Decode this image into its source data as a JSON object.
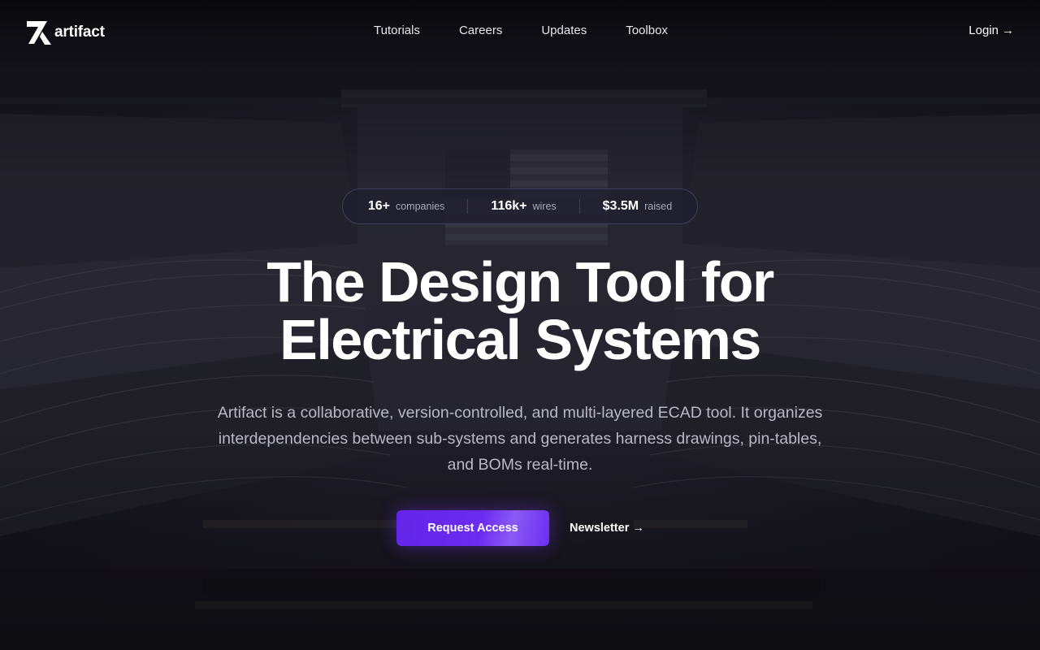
{
  "brand": {
    "name": "artifact",
    "logo_icon": "artifact-logo-icon"
  },
  "nav": {
    "links": [
      {
        "label": "Tutorials"
      },
      {
        "label": "Careers"
      },
      {
        "label": "Updates"
      },
      {
        "label": "Toolbox"
      }
    ],
    "login_label": "Login",
    "login_arrow": "→"
  },
  "stats": [
    {
      "value": "16+",
      "label": "companies"
    },
    {
      "value": "116k+",
      "label": "wires"
    },
    {
      "value": "$3.5M",
      "label": "raised"
    }
  ],
  "hero": {
    "headline_line1": "The Design Tool for",
    "headline_line2": "Electrical Systems",
    "description": "Artifact is a collaborative, version-controlled, and multi-layered ECAD tool. It organizes interdependencies between sub-systems and generates harness drawings, pin-tables, and BOMs real-time.",
    "primary_cta": "Request Access",
    "secondary_cta": "Newsletter",
    "secondary_arrow": "→"
  },
  "colors": {
    "accent": "#6b2ef0",
    "background": "#16151d",
    "text_muted": "#b9b8c6"
  }
}
